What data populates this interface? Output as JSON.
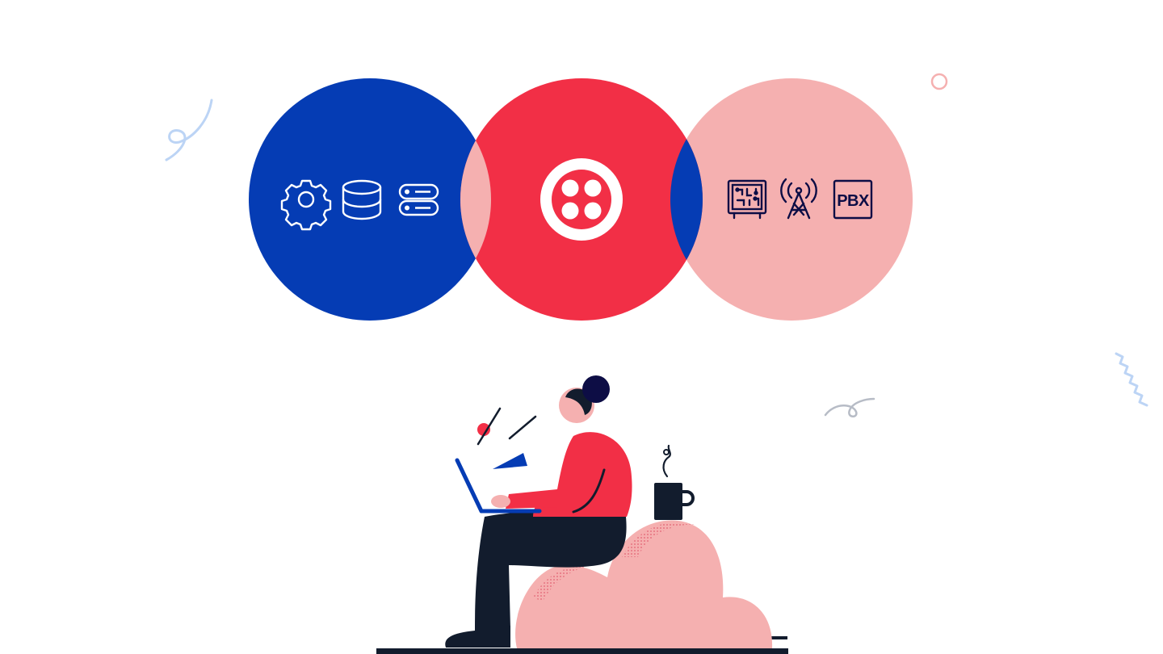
{
  "colors": {
    "background": "#ffffff",
    "brand_blue": "#053cb4",
    "brand_red": "#f22f46",
    "brand_pink": "#f5b0b0",
    "navy": "#121c2d",
    "dark_navy": "#0d0d45",
    "decor_blue": "#bcd4f5",
    "decor_gray": "#b7bcc6"
  },
  "icons": {
    "left_group": [
      "gear-icon",
      "database-icon",
      "server-icon"
    ],
    "center": "twilio-logo-icon",
    "right_group": [
      "circuit-board-icon",
      "radio-tower-icon",
      "pbx-icon"
    ]
  },
  "labels": {
    "pbx": "PBX"
  }
}
